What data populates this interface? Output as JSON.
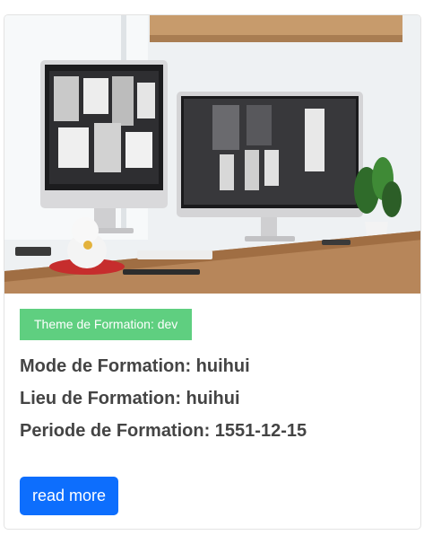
{
  "card": {
    "image": {
      "description": "desk-workspace-photo",
      "colors": {
        "wall": "#eef1f3",
        "desk": "#b7865a",
        "screen": "#2b2b2d"
      }
    },
    "badge_text": "Theme de Formation: dev",
    "details": [
      "Mode de Formation: huihui",
      "Lieu de Formation: huihui",
      "Periode de Formation: 1551-12-15"
    ],
    "button_label": "read more",
    "colors": {
      "badge": "#5fcf80",
      "button": "#0d6efd",
      "text": "#444444"
    }
  }
}
